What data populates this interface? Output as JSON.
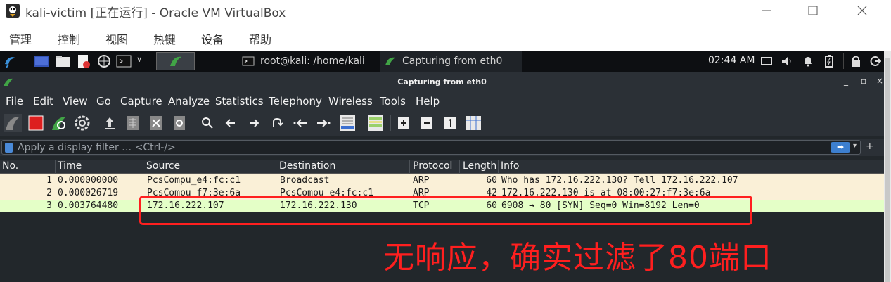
{
  "vbox": {
    "title": "kali-victim [正在运行] - Oracle VM VirtualBox",
    "menu": [
      "管理",
      "控制",
      "视图",
      "热键",
      "设备",
      "帮助"
    ]
  },
  "panel": {
    "tasks": [
      {
        "label": "root@kali: /home/kali"
      },
      {
        "label": "Capturing from eth0"
      }
    ],
    "clock": "02:44 AM"
  },
  "wireshark": {
    "title": "Capturing from eth0",
    "menu": [
      "File",
      "Edit",
      "View",
      "Go",
      "Capture",
      "Analyze",
      "Statistics",
      "Telephony",
      "Wireless",
      "Tools",
      "Help"
    ],
    "filter_placeholder": "Apply a display filter … <Ctrl-/>",
    "columns": [
      "No.",
      "Time",
      "Source",
      "Destination",
      "Protocol",
      "Length",
      "Info"
    ],
    "packets": [
      {
        "no": "1",
        "time": "0.000000000",
        "source": "PcsCompu_e4:fc:c1",
        "destination": "Broadcast",
        "protocol": "ARP",
        "length": "60",
        "info": "Who has 172.16.222.130? Tell 172.16.222.107",
        "bg": "#faf0d7"
      },
      {
        "no": "2",
        "time": "0.000026719",
        "source": "PcsCompu_f7:3e:6a",
        "destination": "PcsCompu_e4:fc:c1",
        "protocol": "ARP",
        "length": "42",
        "info": "172.16.222.130 is at 08:00:27:f7:3e:6a",
        "bg": "#faf0d7"
      },
      {
        "no": "3",
        "time": "0.003764480",
        "source": "172.16.222.107",
        "destination": "172.16.222.130",
        "protocol": "TCP",
        "length": "60",
        "info": "6908 → 80 [SYN] Seq=0 Win=8192 Len=0",
        "bg": "#e4ffc7"
      }
    ]
  },
  "annotation": "无响应，确实过滤了80端口",
  "colors": {
    "annotation": "#ff1f1f",
    "arp_row": "#faf0d7",
    "tcp_row": "#e4ffc7"
  }
}
